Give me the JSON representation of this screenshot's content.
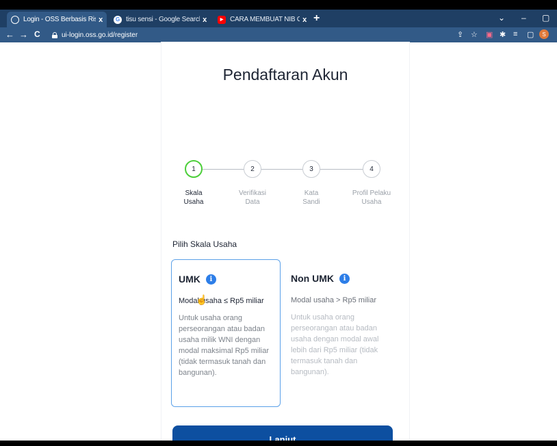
{
  "browser": {
    "tabs": [
      {
        "title": "Login - OSS Berbasis Risiko",
        "icon": "oss-favicon"
      },
      {
        "title": "tisu sensi - Google Search",
        "icon": "google-favicon"
      },
      {
        "title": "CARA MEMBUAT NIB ONLINE DI",
        "icon": "youtube-favicon"
      }
    ],
    "tab_close": "x",
    "new_tab": "+",
    "url": "ui-login.oss.go.id/register",
    "window_controls": {
      "collapse": "⌄",
      "minimize": "–",
      "maximize": "▢"
    },
    "profile_initial": "S"
  },
  "page": {
    "title": "Pendaftaran Akun",
    "steps": [
      {
        "number": "1",
        "label": "Skala Usaha",
        "active": true
      },
      {
        "number": "2",
        "label": "Verifikasi Data",
        "active": false
      },
      {
        "number": "3",
        "label": "Kata Sandi",
        "active": false
      },
      {
        "number": "4",
        "label": "Profil Pelaku Usaha",
        "active": false
      }
    ],
    "section_label": "Pilih Skala Usaha",
    "options": [
      {
        "title": "UMK",
        "subtitle": "Modal usaha ≤ Rp5 miliar",
        "description": "Untuk usaha orang perseorangan atau badan usaha milik WNI dengan modal maksimal Rp5 miliar (tidak termasuk tanah dan bangunan).",
        "selected": true
      },
      {
        "title": "Non UMK",
        "subtitle": "Modal usaha > Rp5 miliar",
        "description": "Untuk usaha orang perseorangan atau badan usaha dengan modal awal lebih dari Rp5 miliar (tidak termasuk tanah dan bangunan).",
        "selected": false
      }
    ],
    "submit_label": "Lanjut"
  },
  "colors": {
    "tab_strip": "#1f3f64",
    "toolbar": "#325a87",
    "active_step": "#4ccf3a",
    "selected_border": "#5aa0e8",
    "primary_button": "#0d4fa0",
    "info_icon": "#2d7ee8"
  }
}
